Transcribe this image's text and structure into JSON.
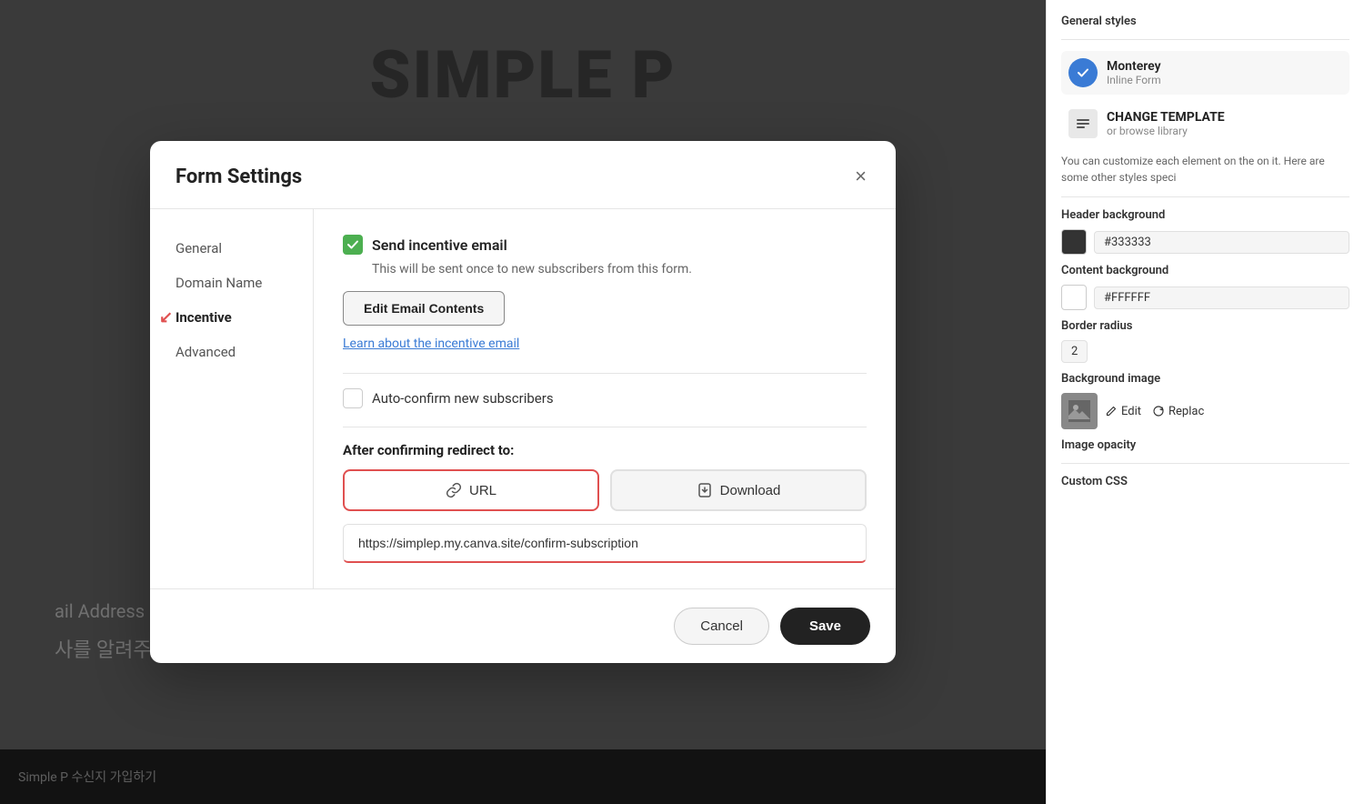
{
  "background": {
    "title": "SIMPLE P",
    "email_label": "ail Address",
    "korean_text": "사를 알려주세요!",
    "bottom_bar_text": "Simple P  수신지 가입하기"
  },
  "right_panel": {
    "section_title": "General styles",
    "template_name": "Monterey",
    "template_type": "Inline Form",
    "change_template_main": "CHANGE TEMPLATE",
    "change_template_sub": "or browse library",
    "panel_description": "You can customize each element on the on it. Here are some other styles speci",
    "header_background_label": "Header background",
    "header_bg_color": "#333333",
    "content_background_label": "Content background",
    "content_bg_color": "#FFFFFF",
    "border_radius_label": "Border radius",
    "border_radius_value": "2",
    "bg_image_label": "Background image",
    "edit_label": "Edit",
    "replace_label": "Replac",
    "image_opacity_label": "Image opacity",
    "custom_css_label": "Custom CSS"
  },
  "modal": {
    "title": "Form Settings",
    "close_icon": "×",
    "nav": {
      "items": [
        {
          "label": "General",
          "active": false
        },
        {
          "label": "Domain Name",
          "active": false
        },
        {
          "label": "Incentive",
          "active": true
        },
        {
          "label": "Advanced",
          "active": false
        }
      ]
    },
    "content": {
      "send_incentive_label": "Send incentive email",
      "send_incentive_desc": "This will be sent once to new subscribers from this form.",
      "edit_email_btn": "Edit Email Contents",
      "learn_link": "Learn about the incentive email",
      "auto_confirm_label": "Auto-confirm new subscribers",
      "redirect_label": "After confirming redirect to:",
      "redirect_buttons": [
        {
          "label": "URL",
          "icon": "link",
          "selected": true
        },
        {
          "label": "Download",
          "icon": "download",
          "selected": false
        }
      ],
      "url_value": "https://simplep.my.canva.site/confirm-subscription"
    },
    "footer": {
      "cancel_label": "Cancel",
      "save_label": "Save"
    }
  }
}
